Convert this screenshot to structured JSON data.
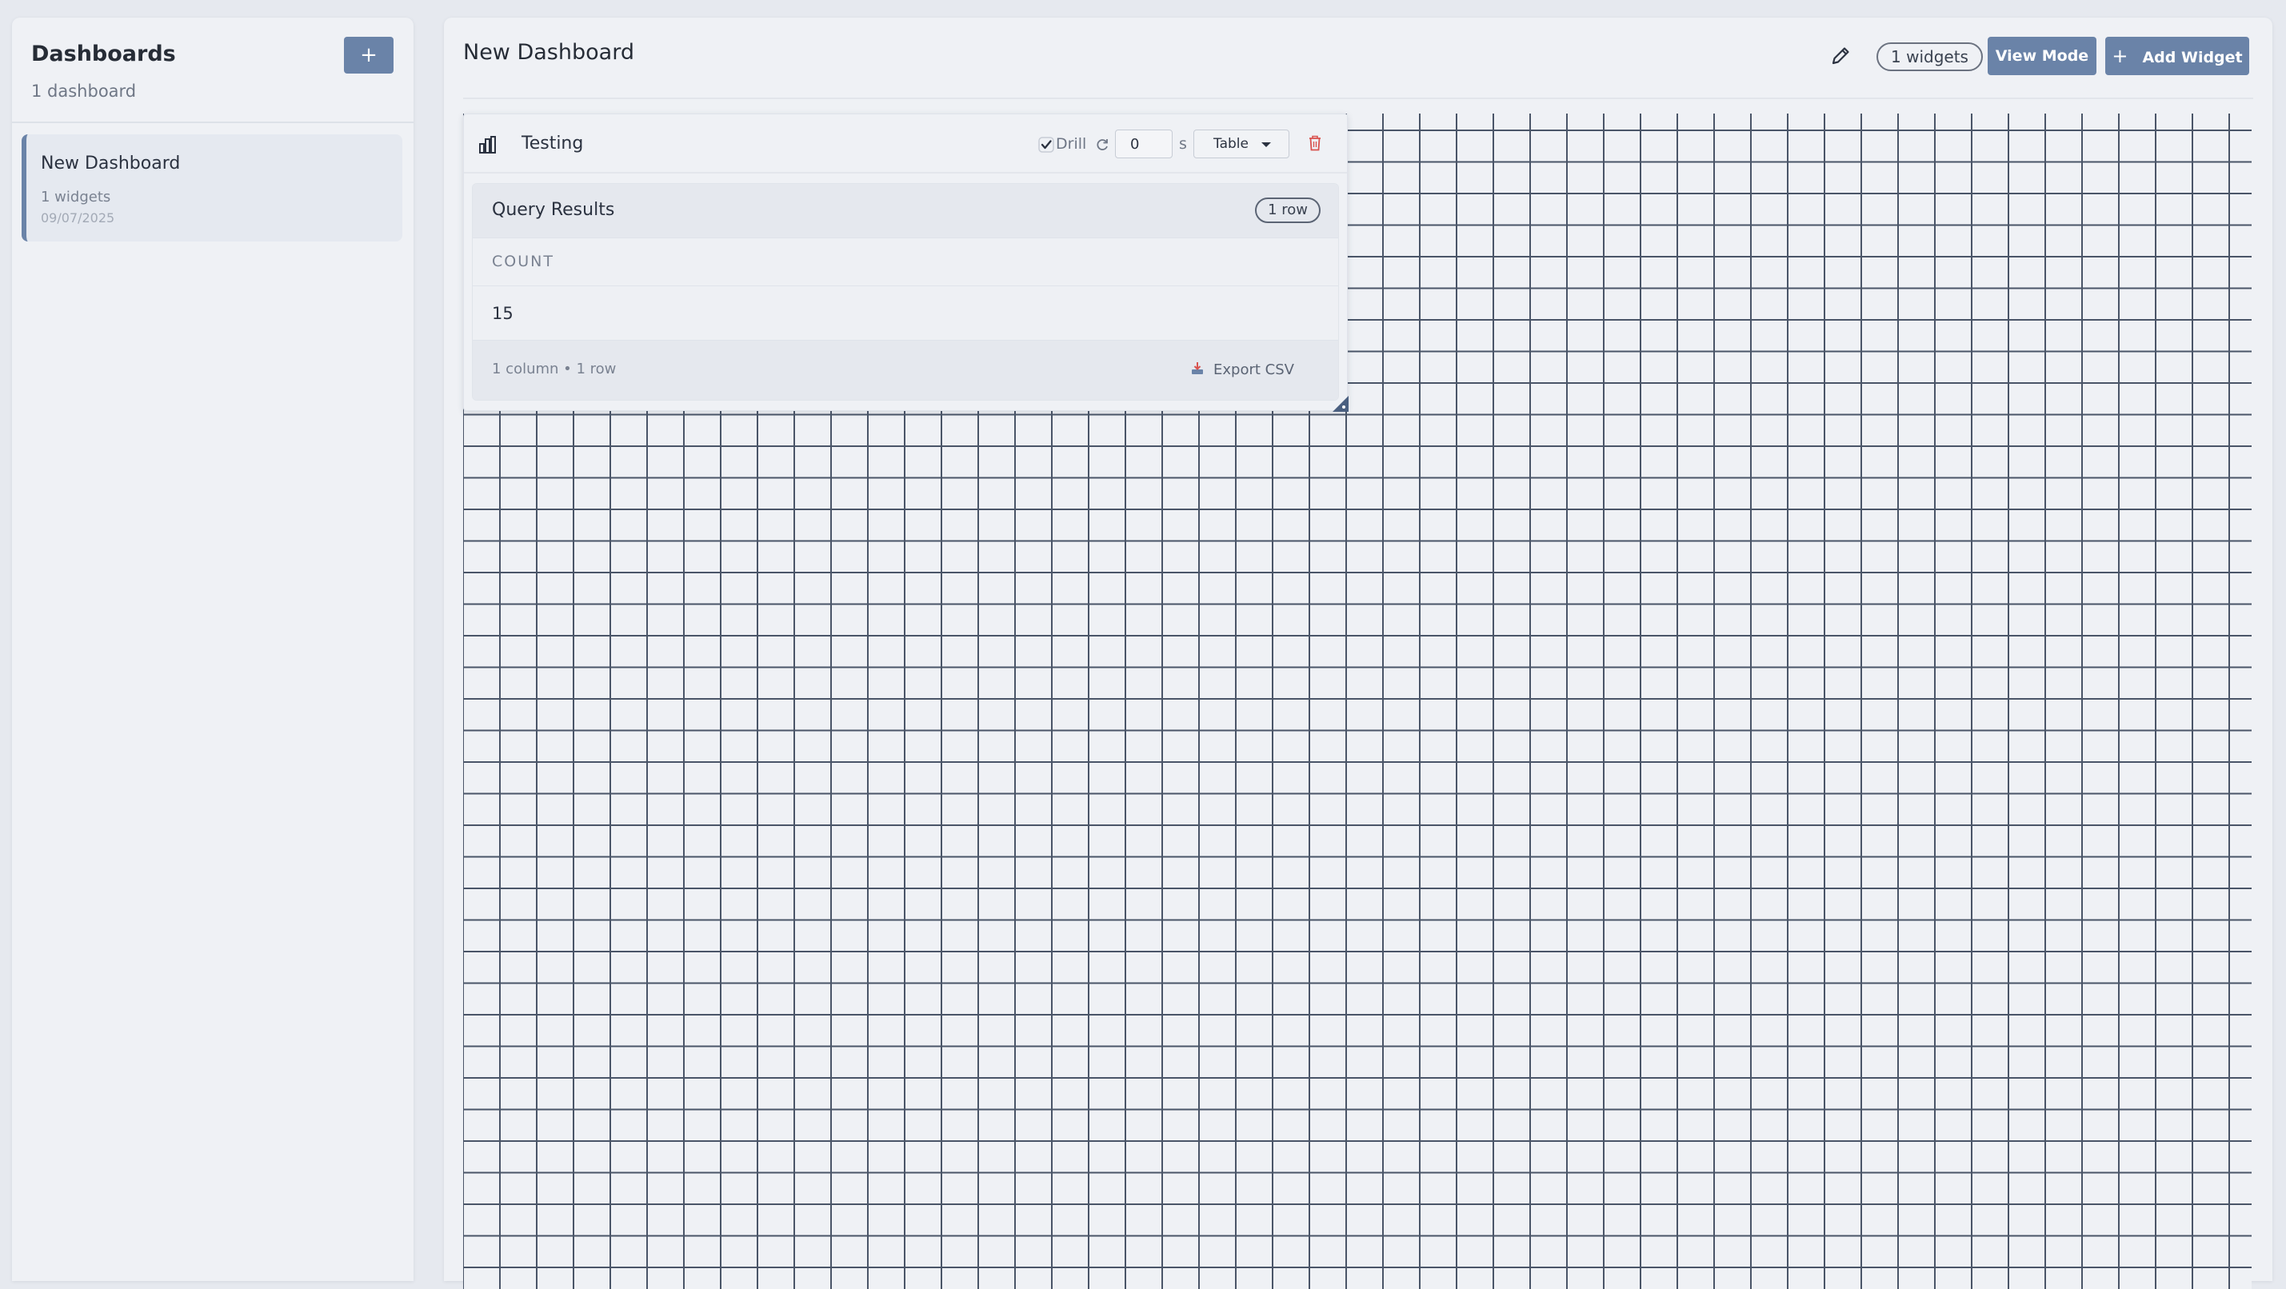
{
  "sidebar": {
    "title": "Dashboards",
    "count": "1 dashboard",
    "add_label": "+",
    "items": [
      {
        "name": "New Dashboard",
        "widgets": "1 widgets",
        "date": "09/07/2025"
      }
    ]
  },
  "main": {
    "title": "New Dashboard",
    "widgets_badge": "1 widgets",
    "view_mode_label": "View Mode",
    "add_widget_label": "Add Widget",
    "add_widget_icon": "+"
  },
  "widget": {
    "title": "Testing",
    "type_icon": "bar-chart-icon",
    "drill_label": "Drill",
    "drill_checked": true,
    "refresh_value": "0",
    "refresh_unit": "s",
    "type_select": "Table",
    "results": {
      "title": "Query Results",
      "rows_badge": "1 row",
      "columns": [
        "COUNT"
      ],
      "rows": [
        [
          "15"
        ]
      ],
      "footer_info": "1 column • 1 row",
      "export_label": "Export CSV"
    }
  },
  "colors": {
    "accent": "#6a83a8",
    "danger": "#d9534f",
    "grid_line": "#4a5568",
    "panel_bg": "#eff1f5",
    "page_bg": "#e6e9ef"
  }
}
